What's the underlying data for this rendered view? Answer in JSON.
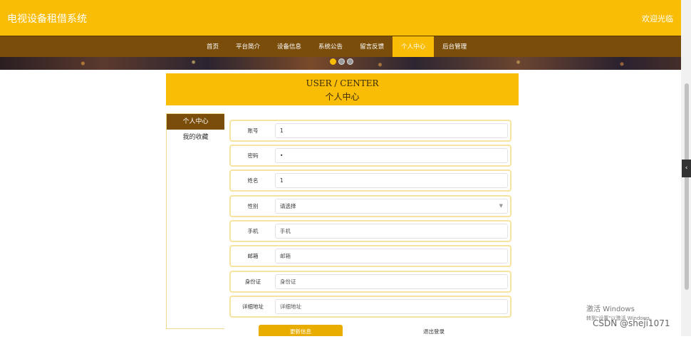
{
  "header": {
    "title": "电视设备租借系统",
    "welcome": "欢迎光临"
  },
  "nav": {
    "items": [
      {
        "label": "首页"
      },
      {
        "label": "平台简介"
      },
      {
        "label": "设备信息"
      },
      {
        "label": "系统公告"
      },
      {
        "label": "留言反馈"
      },
      {
        "label": "个人中心"
      },
      {
        "label": "后台管理"
      }
    ],
    "active_index": 5
  },
  "banner": {
    "dot_count": 3,
    "active_dot": 0
  },
  "section": {
    "title_en": "USER / CENTER",
    "title_cn": "个人中心"
  },
  "sidebar": {
    "items": [
      {
        "label": "个人中心"
      },
      {
        "label": "我的收藏"
      }
    ],
    "active_index": 0
  },
  "form": {
    "account": {
      "label": "账号",
      "value": "1"
    },
    "password": {
      "label": "密码",
      "value": "•"
    },
    "name": {
      "label": "姓名",
      "value": "1"
    },
    "gender": {
      "label": "性别",
      "value": "请选择"
    },
    "phone": {
      "label": "手机",
      "placeholder": "手机"
    },
    "email": {
      "label": "邮箱",
      "placeholder": "邮箱"
    },
    "id_card": {
      "label": "身份证",
      "placeholder": "身份证"
    },
    "address": {
      "label": "详细地址",
      "placeholder": "详细地址"
    }
  },
  "buttons": {
    "update": "更新信息",
    "logout": "退出登录"
  },
  "overlay": {
    "activation_title": "激活 Windows",
    "activation_sub": "转到\"设置\"以激活 Windows。",
    "watermark": "CSDN @sheji1071"
  },
  "colors": {
    "primary": "#f9bd06",
    "nav_bg": "#7a4d0b",
    "row_border": "#f7e3a0"
  }
}
